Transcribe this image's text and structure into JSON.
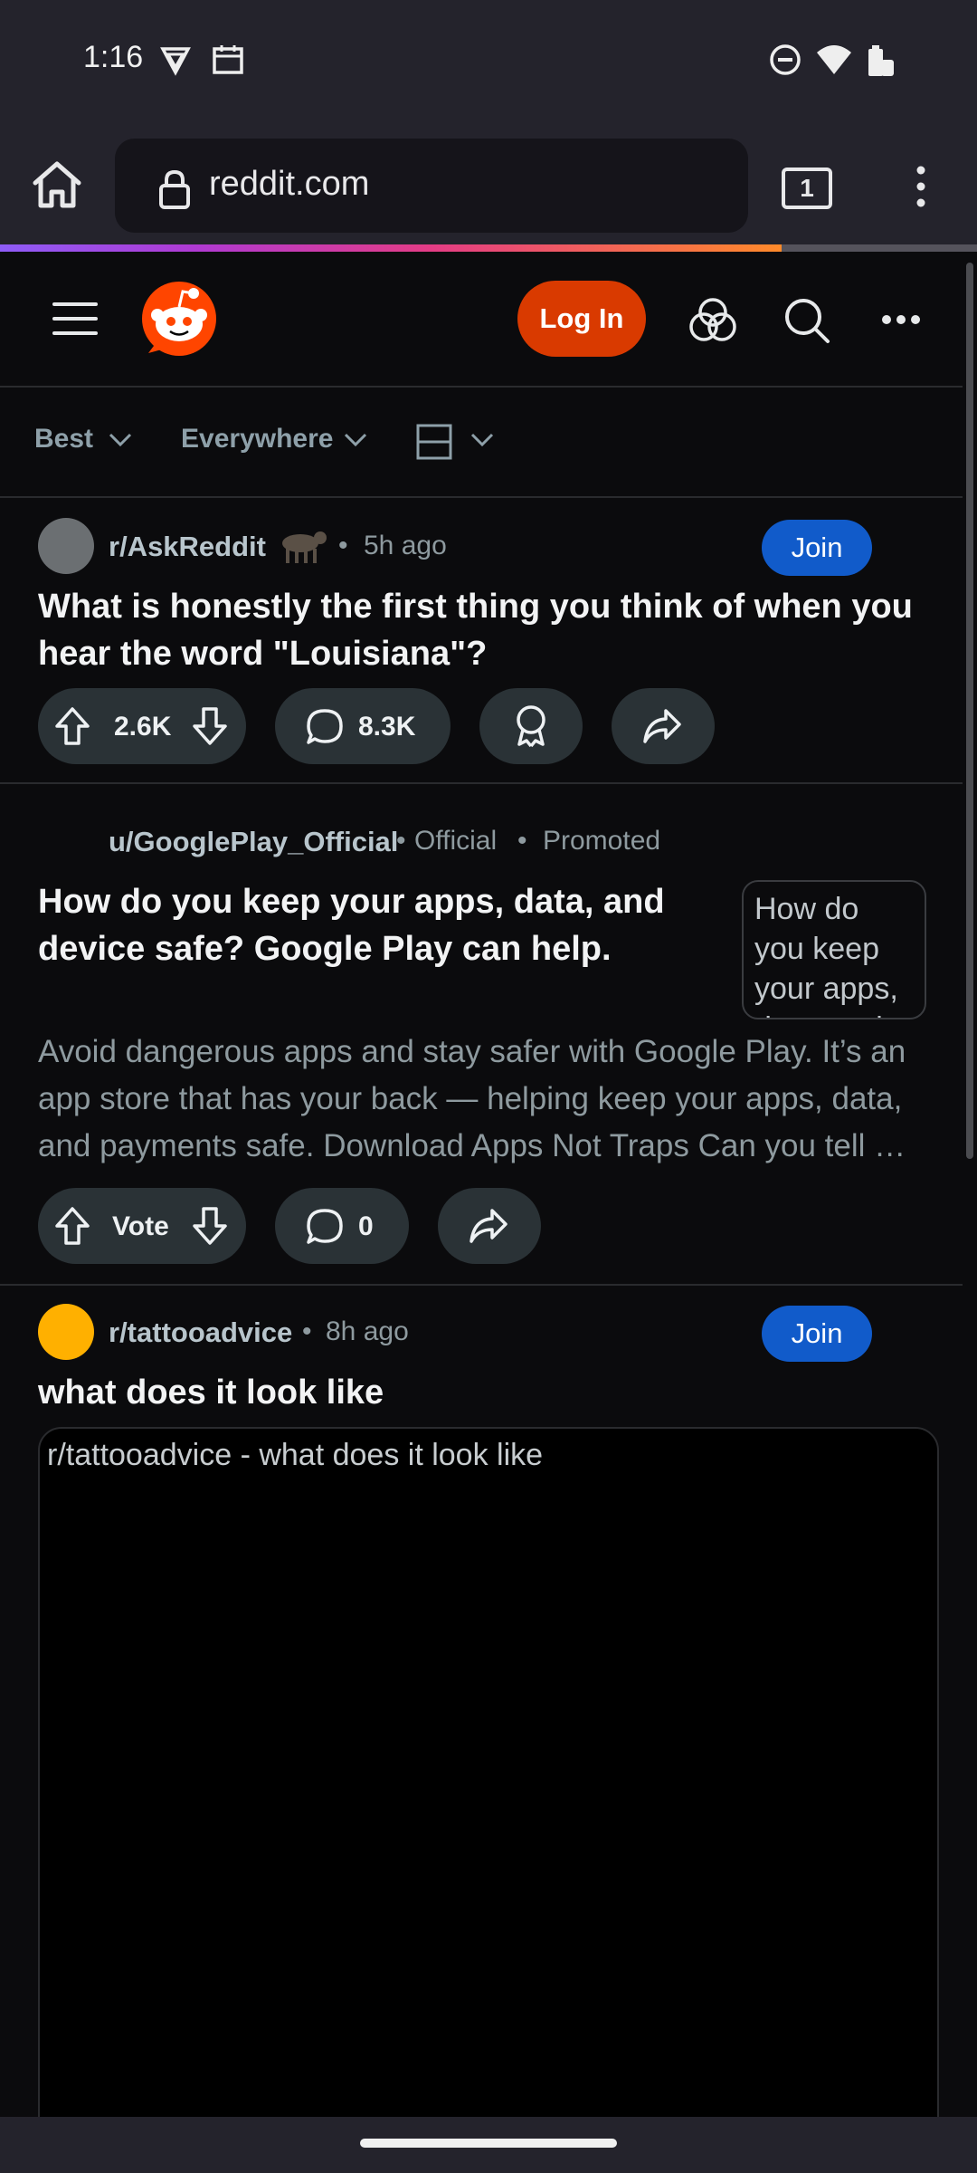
{
  "status_bar": {
    "time": "1:16"
  },
  "browser": {
    "url": "reddit.com",
    "tab_count": "1",
    "load_progress": 0.8
  },
  "reddit_header": {
    "login_label": "Log In"
  },
  "filters": {
    "sort": "Best",
    "location": "Everywhere"
  },
  "posts": [
    {
      "subreddit": "r/AskReddit",
      "time": "5h ago",
      "join_label": "Join",
      "title": "What is honestly the first thing you think of when you hear the word \"Louisiana\"?",
      "votes": "2.6K",
      "comments": "8.3K"
    },
    {
      "author": "u/GooglePlay_Official",
      "official": "Official",
      "promoted": "Promoted",
      "title": "How do you keep your apps, data, and device safe? Google Play can help.",
      "thumb_text": "How do you keep your apps, data, and device safe?",
      "body": "Avoid dangerous apps and stay safer with Google Play. It’s an app store that has your back — helping keep your apps, data, and payments safe. Download Apps Not Traps Can you tell …",
      "votes": "Vote",
      "comments": "0"
    },
    {
      "subreddit": "r/tattooadvice",
      "time": "8h ago",
      "join_label": "Join",
      "title": "what does it look like",
      "media_alt": "r/tattooadvice - what does it look like"
    }
  ],
  "colors": {
    "login": "#d93a00",
    "join": "#115bca",
    "background": "#0b0b0d",
    "pill": "#2a3236"
  }
}
